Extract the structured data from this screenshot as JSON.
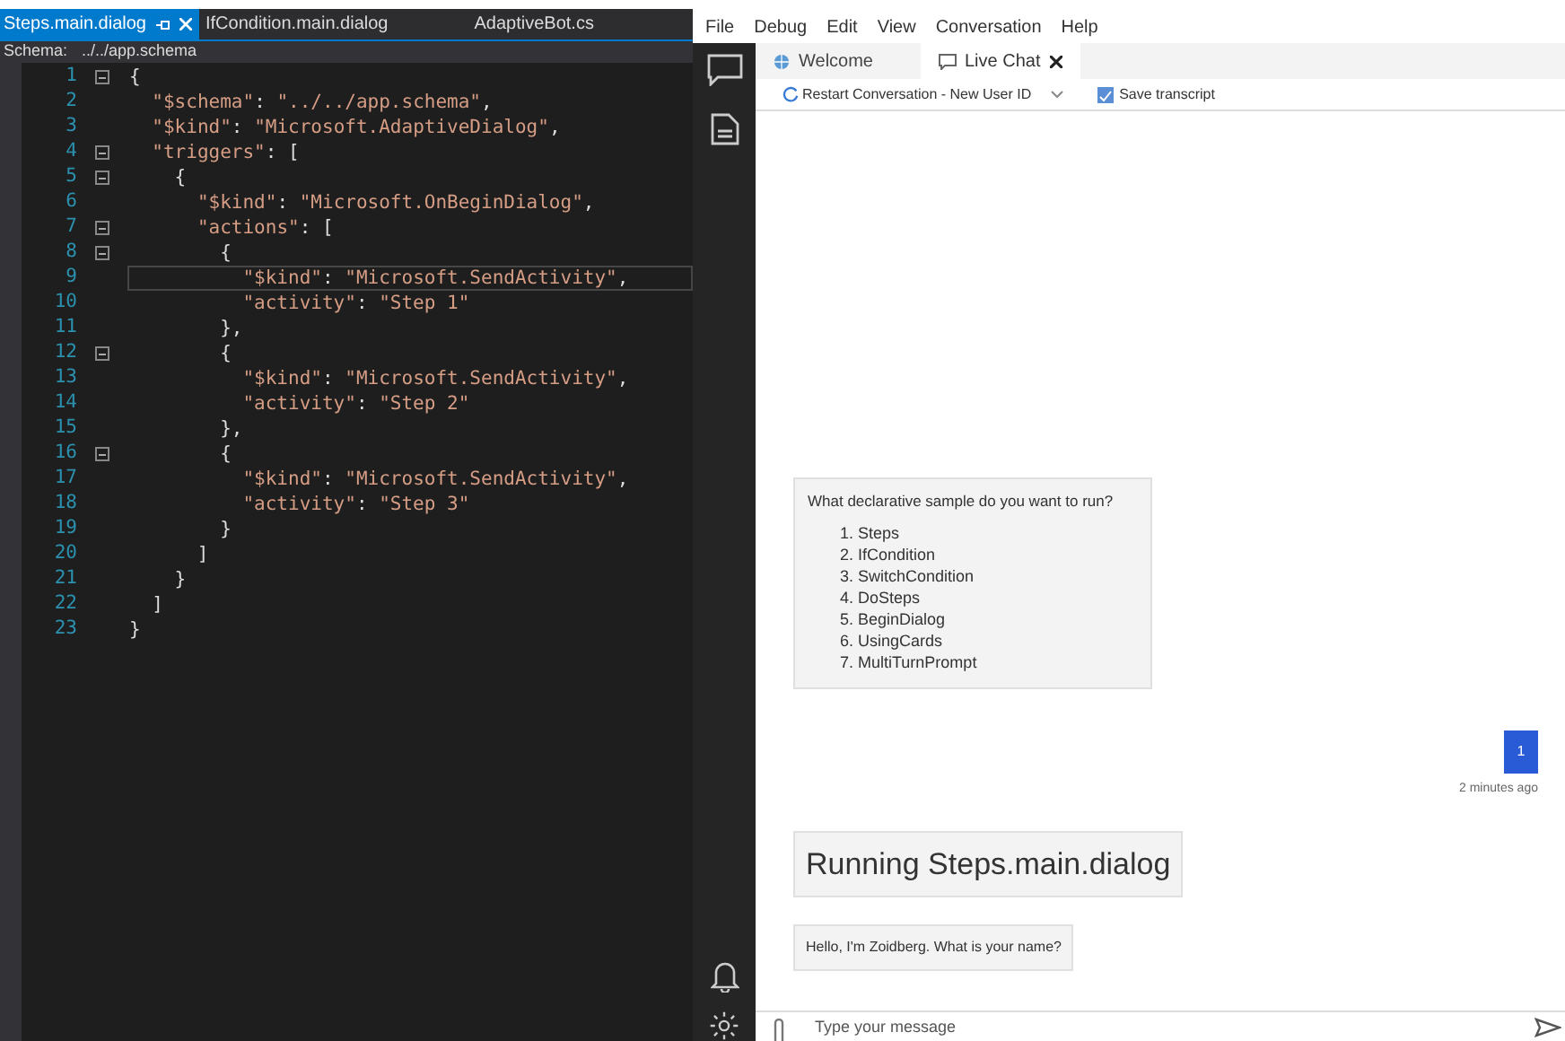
{
  "editor": {
    "tabs": [
      {
        "label": "Steps.main.dialog",
        "selected": true,
        "pinned": true,
        "closable": true
      },
      {
        "label": "IfCondition.main.dialog",
        "selected": false,
        "pinned": false,
        "closable": false
      },
      {
        "label": "AdaptiveBot.cs",
        "selected": false,
        "pinned": false,
        "closable": false
      }
    ],
    "schema_label": "Schema:",
    "schema_value": "../../app.schema",
    "lines": [
      {
        "number": "1",
        "text": "{",
        "fold": true,
        "current": false
      },
      {
        "number": "2",
        "text": "  \"$schema\": \"../../app.schema\",",
        "fold": false,
        "current": false
      },
      {
        "number": "3",
        "text": "  \"$kind\": \"Microsoft.AdaptiveDialog\",",
        "fold": false,
        "current": false
      },
      {
        "number": "4",
        "text": "  \"triggers\": [",
        "fold": true,
        "current": false
      },
      {
        "number": "5",
        "text": "    {",
        "fold": true,
        "current": false
      },
      {
        "number": "6",
        "text": "      \"$kind\": \"Microsoft.OnBeginDialog\",",
        "fold": false,
        "current": false
      },
      {
        "number": "7",
        "text": "      \"actions\": [",
        "fold": true,
        "current": false
      },
      {
        "number": "8",
        "text": "        {",
        "fold": true,
        "current": false
      },
      {
        "number": "9",
        "text": "          \"$kind\": \"Microsoft.SendActivity\",",
        "fold": false,
        "current": true
      },
      {
        "number": "10",
        "text": "          \"activity\": \"Step 1\"",
        "fold": false,
        "current": false
      },
      {
        "number": "11",
        "text": "        },",
        "fold": false,
        "current": false
      },
      {
        "number": "12",
        "text": "        {",
        "fold": true,
        "current": false
      },
      {
        "number": "13",
        "text": "          \"$kind\": \"Microsoft.SendActivity\",",
        "fold": false,
        "current": false
      },
      {
        "number": "14",
        "text": "          \"activity\": \"Step 2\"",
        "fold": false,
        "current": false
      },
      {
        "number": "15",
        "text": "        },",
        "fold": false,
        "current": false
      },
      {
        "number": "16",
        "text": "        {",
        "fold": true,
        "current": false
      },
      {
        "number": "17",
        "text": "          \"$kind\": \"Microsoft.SendActivity\",",
        "fold": false,
        "current": false
      },
      {
        "number": "18",
        "text": "          \"activity\": \"Step 3\"",
        "fold": false,
        "current": false
      },
      {
        "number": "19",
        "text": "        }",
        "fold": false,
        "current": false
      },
      {
        "number": "20",
        "text": "      ]",
        "fold": false,
        "current": false
      },
      {
        "number": "21",
        "text": "    }",
        "fold": false,
        "current": false
      },
      {
        "number": "22",
        "text": "  ]",
        "fold": false,
        "current": false
      },
      {
        "number": "23",
        "text": "}",
        "fold": false,
        "current": false
      }
    ]
  },
  "emulator": {
    "menu": [
      "File",
      "Debug",
      "Edit",
      "View",
      "Conversation",
      "Help"
    ],
    "tabs": [
      {
        "label": "Welcome",
        "kind": "globe",
        "selected": false,
        "closable": false
      },
      {
        "label": "Live Chat",
        "kind": "chat",
        "selected": true,
        "closable": true
      }
    ],
    "restart_button": "Restart Conversation - New User ID",
    "save_button": "Save transcript",
    "messages": [
      {
        "kind": "list",
        "text": "What declarative sample do you want to run?",
        "items": [
          "1. Steps",
          "2. IfCondition",
          "3. SwitchCondition",
          "4. DoSteps",
          "5. BeginDialog",
          "6. UsingCards",
          "7. MultiTurnPrompt"
        ]
      },
      {
        "kind": "user",
        "text": "1",
        "time": "2 minutes ago"
      },
      {
        "kind": "large",
        "text": "Running Steps.main.dialog"
      },
      {
        "kind": "bot",
        "text": "Hello, I'm Zoidberg. What is your name?"
      }
    ],
    "input": {
      "placeholder": "Type your message"
    }
  }
}
